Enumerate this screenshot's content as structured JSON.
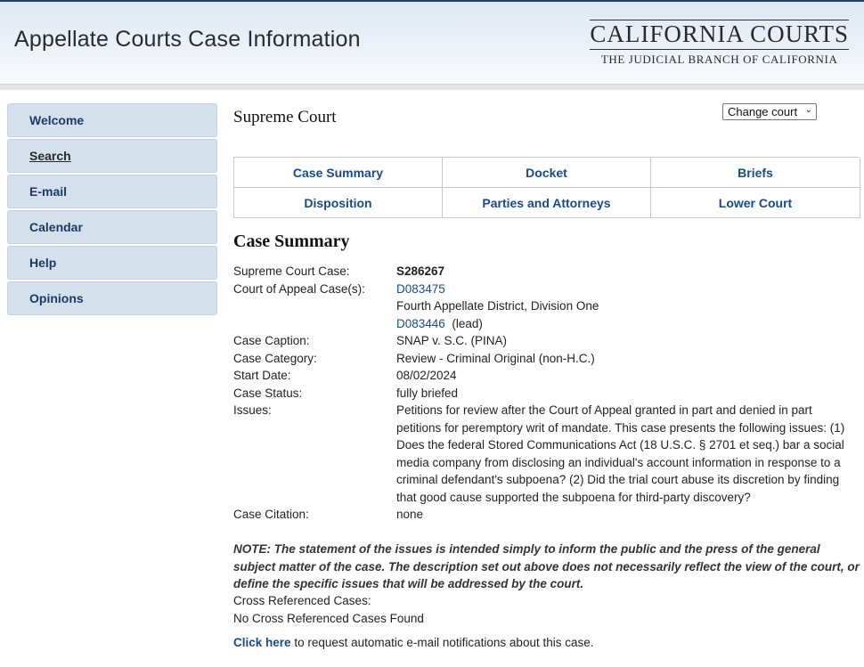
{
  "header": {
    "app_title": "Appellate Courts Case Information",
    "brand_top": "CALIFORNIA COURTS",
    "brand_sub": "THE JUDICIAL BRANCH OF CALIFORNIA"
  },
  "sidebar": {
    "items": [
      {
        "label": "Welcome"
      },
      {
        "label": "Search"
      },
      {
        "label": "E-mail"
      },
      {
        "label": "Calendar"
      },
      {
        "label": "Help"
      },
      {
        "label": "Opinions"
      }
    ],
    "active": "Search"
  },
  "main": {
    "court_title": "Supreme Court",
    "court_select": "Change court",
    "tabs": [
      {
        "label": "Case Summary"
      },
      {
        "label": "Docket"
      },
      {
        "label": "Briefs"
      },
      {
        "label": "Disposition"
      },
      {
        "label": "Parties and Attorneys"
      },
      {
        "label": "Lower Court"
      }
    ],
    "section_title": "Case Summary",
    "details": {
      "supreme_case_label": "Supreme Court Case:",
      "supreme_case_value": "S286267",
      "coa_label": "Court of Appeal Case(s):",
      "coa_case_1": "D083475",
      "coa_district": "Fourth Appellate District, Division One",
      "coa_case_2": "D083446",
      "coa_case_2_suffix": "(lead)",
      "caption_label": "Case Caption:",
      "caption_value": "SNAP v. S.C. (PINA)",
      "category_label": "Case Category:",
      "category_value": "Review - Criminal Original (non-H.C.)",
      "start_label": "Start Date:",
      "start_value": "08/02/2024",
      "status_label": "Case Status:",
      "status_value": "fully briefed",
      "issues_label": "Issues:",
      "issues_value": "Petitions for review after the Court of Appeal granted in part and denied in part petitions for peremptory writ of mandate. This case presents the following issues: (1) Does the federal Stored Communications Act (18 U.S.C. § 2701 et seq.) bar a social media company from disclosing an individual's account information in response to a criminal defendant's subpoena? (2) Did the trial court abuse its discretion by finding that good cause supported the subpoena for third-party discovery?",
      "citation_label": "Case Citation:",
      "citation_value": "none"
    },
    "note": "NOTE: The statement of the issues is intended simply to inform the public and the press of the general subject matter of the case. The description set out above does not necessarily reflect the view of the court, or define the specific issues that will be addressed by the court.",
    "xref_label": "Cross Referenced Cases:",
    "xref_value": "No Cross Referenced Cases Found",
    "notify_link": "Click here",
    "notify_text": "to request automatic e-mail notifications about this case."
  }
}
